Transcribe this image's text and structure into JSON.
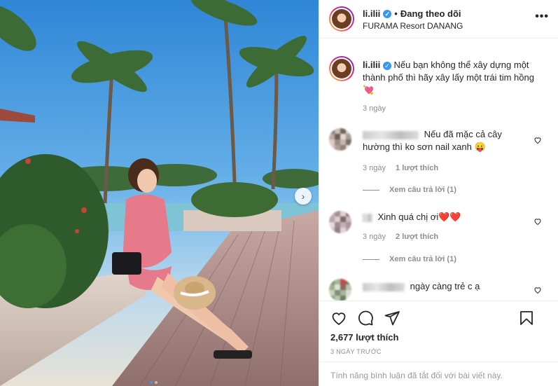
{
  "post": {
    "username": "li.ilii",
    "follow_state": "Đang theo dõi",
    "separator": "•",
    "location": "FURAMA Resort DANANG",
    "more": "•••"
  },
  "caption": {
    "username": "li.ilii",
    "text": "Nếu bạn không thể xây dựng một thành phố thì hãy xây lấy một trái tim hồng 💘",
    "ago": "3 ngày"
  },
  "comments": [
    {
      "text": "Nếu đã mặc cả cây hường thì ko sơn nail xanh 😛",
      "ago": "3 ngày",
      "likes": "1 lượt thích",
      "replies": "Xem câu trả lời (1)"
    },
    {
      "text": "Xinh quá chị ơi❤️❤️",
      "ago": "3 ngày",
      "likes": "2 lượt thích",
      "replies": "Xem câu trả lời (1)"
    },
    {
      "text": "ngày càng trẻ c ạ"
    }
  ],
  "actions": {
    "likes": "2,677 lượt thích",
    "date": "3 NGÀY TRƯỚC",
    "comments_disabled": "Tính năng bình luận đã tắt đối với bài viết này."
  },
  "icons": {
    "verified": "verified-badge-icon",
    "like": "heart-icon",
    "comment": "comment-bubble-icon",
    "share": "paper-plane-icon",
    "save": "bookmark-icon",
    "next": "chevron-right-icon"
  },
  "colors": {
    "verified": "#3897f0",
    "muted": "#8e8e8e",
    "text": "#262626"
  }
}
